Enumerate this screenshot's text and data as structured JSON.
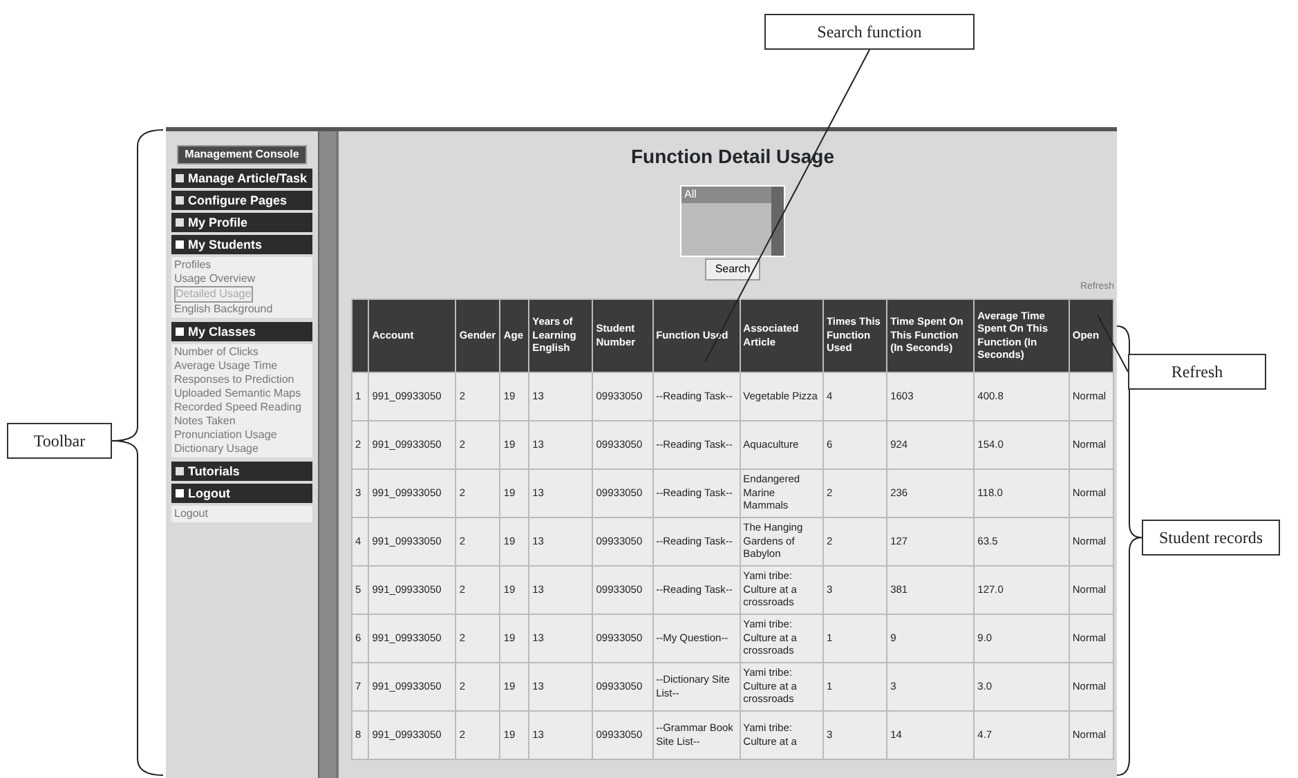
{
  "console": {
    "title": "Management Console",
    "sections": [
      {
        "label": "Manage Article/Task",
        "expanded": false
      },
      {
        "label": "Configure Pages",
        "expanded": false
      },
      {
        "label": "My Profile",
        "expanded": false
      },
      {
        "label": "My Students",
        "expanded": true,
        "items": [
          {
            "label": "Profiles",
            "selected": false
          },
          {
            "label": "Usage Overview",
            "selected": false
          },
          {
            "label": "Detailed Usage",
            "selected": true
          },
          {
            "label": "English Background",
            "selected": false
          }
        ]
      },
      {
        "label": "My Classes",
        "expanded": true,
        "items": [
          {
            "label": "Number of Clicks",
            "selected": false
          },
          {
            "label": "Average Usage Time",
            "selected": false
          },
          {
            "label": "Responses to Prediction",
            "selected": false
          },
          {
            "label": "Uploaded Semantic Maps",
            "selected": false
          },
          {
            "label": "Recorded Speed Reading",
            "selected": false
          },
          {
            "label": "Notes Taken",
            "selected": false
          },
          {
            "label": "Pronunciation Usage",
            "selected": false
          },
          {
            "label": "Dictionary Usage",
            "selected": false
          }
        ]
      },
      {
        "label": "Tutorials",
        "expanded": false
      },
      {
        "label": "Logout",
        "expanded": true,
        "items": [
          {
            "label": "Logout",
            "selected": false
          }
        ]
      }
    ]
  },
  "page": {
    "title": "Function Detail Usage",
    "filter": {
      "options": [
        {
          "label": "All",
          "selected": true
        }
      ]
    },
    "search_button": "Search",
    "refresh_link": "Refresh"
  },
  "table": {
    "columns": [
      "Account",
      "Gender",
      "Age",
      "Years of Learning English",
      "Student Number",
      "Function Used",
      "Associated Article",
      "Times This Function Used",
      "Time Spent On This Function (In Seconds)",
      "Average Time Spent On This Function (In Seconds)",
      "Open"
    ],
    "rows": [
      {
        "number": "1",
        "cells": [
          "991_09933050",
          "2",
          "19",
          "13",
          "09933050",
          "--Reading Task--",
          "Vegetable Pizza",
          "4",
          "1603",
          "400.8",
          "Normal"
        ]
      },
      {
        "number": "2",
        "cells": [
          "991_09933050",
          "2",
          "19",
          "13",
          "09933050",
          "--Reading Task--",
          "Aquaculture",
          "6",
          "924",
          "154.0",
          "Normal"
        ]
      },
      {
        "number": "3",
        "cells": [
          "991_09933050",
          "2",
          "19",
          "13",
          "09933050",
          "--Reading Task--",
          "Endangered Marine Mammals",
          "2",
          "236",
          "118.0",
          "Normal"
        ]
      },
      {
        "number": "4",
        "cells": [
          "991_09933050",
          "2",
          "19",
          "13",
          "09933050",
          "--Reading Task--",
          "The Hanging Gardens of Babylon",
          "2",
          "127",
          "63.5",
          "Normal"
        ]
      },
      {
        "number": "5",
        "cells": [
          "991_09933050",
          "2",
          "19",
          "13",
          "09933050",
          "--Reading Task--",
          "Yami tribe: Culture at a crossroads",
          "3",
          "381",
          "127.0",
          "Normal"
        ]
      },
      {
        "number": "6",
        "cells": [
          "991_09933050",
          "2",
          "19",
          "13",
          "09933050",
          "--My Question--",
          "Yami tribe: Culture at a crossroads",
          "1",
          "9",
          "9.0",
          "Normal"
        ]
      },
      {
        "number": "7",
        "cells": [
          "991_09933050",
          "2",
          "19",
          "13",
          "09933050",
          "--Dictionary Site List--",
          "Yami tribe: Culture at a crossroads",
          "1",
          "3",
          "3.0",
          "Normal"
        ]
      },
      {
        "number": "8",
        "cells": [
          "991_09933050",
          "2",
          "19",
          "13",
          "09933050",
          "--Grammar Book Site List--",
          "Yami tribe: Culture at a",
          "3",
          "14",
          "4.7",
          "Normal"
        ]
      }
    ]
  },
  "annotations": [
    {
      "kind": "pointer",
      "label": "Search function"
    },
    {
      "kind": "pointer",
      "label": "Refresh"
    },
    {
      "kind": "brace",
      "label": "Toolbar"
    },
    {
      "kind": "brace",
      "label": "Student records"
    }
  ]
}
